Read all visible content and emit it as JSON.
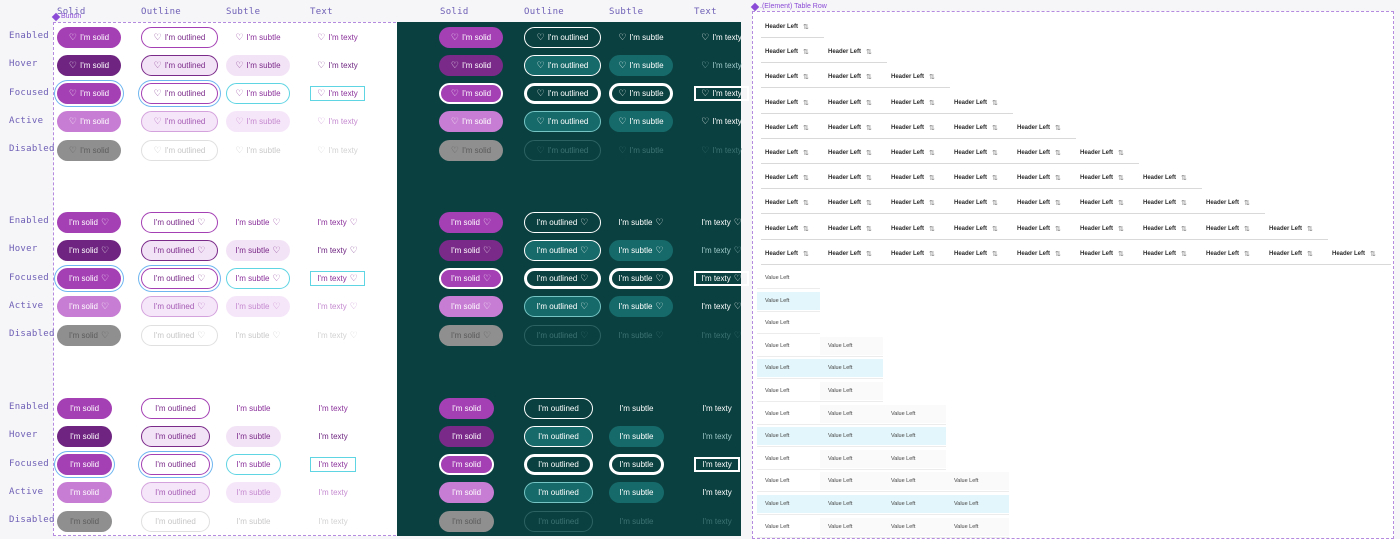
{
  "button_tag": "Button",
  "table_tag": ".(Element) Table Row",
  "column_labels": [
    "Solid",
    "Outline",
    "Subtle",
    "Text"
  ],
  "state_labels": [
    "Enabled",
    "Hover",
    "Focused",
    "Active",
    "Disabled"
  ],
  "button_text": {
    "solid": "I'm solid",
    "outline": "I'm outlined",
    "subtle": "I'm subtle",
    "text": "I'm texty"
  },
  "icons": {
    "heart": "heart-icon",
    "sort": "sort-icon"
  },
  "table": {
    "header_label": "Header Left",
    "sort_glyph": "⇅",
    "value_label": "Value Left"
  },
  "colors": {
    "solid": "#a43fb4",
    "dark_panel": "#0b4040",
    "focus_ring_light": "#5fd4e3",
    "row_highlight": "#e3f6fb"
  }
}
